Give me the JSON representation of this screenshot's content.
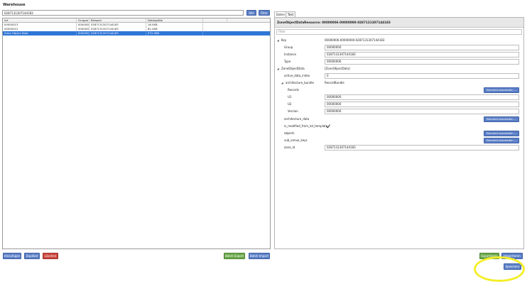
{
  "window": {
    "title": "Warehouse"
  },
  "left": {
    "search_value": "0287131307144183",
    "alle_label": "Alle",
    "filter_label": "Filter",
    "table": {
      "columns": [
        "Art",
        "Gruppe",
        "Beispiel",
        "Dateigröße"
      ],
      "rows": [
        [
          "00000013",
          "00000001",
          "0287131307144183",
          "16.0KB"
        ],
        [
          "00000012",
          "00000001",
          "0287131307144183",
          "82.4KB"
        ],
        [
          "Zone Object Data",
          "00000006",
          "0287131307144183",
          "572.5KB"
        ]
      ],
      "selected_row": 2
    },
    "bottom_buttons": {
      "hinzufuegen": "Hinzufügen",
      "duplikat": "Duplikat",
      "loeschen": "Löschen",
      "batch_export": "Batch Export",
      "batch_import": "Batch Import"
    }
  },
  "right": {
    "tabs": [
      "Daten",
      "Text"
    ],
    "active_tab": "Daten",
    "header": "ZoneObjectDataResource: 00000006-00000000-0287131307144183",
    "filter_placeholder": "Filter",
    "props": {
      "key_label": "Key",
      "key_value": "00000006-00000000-0287131307144183",
      "group_label": "Group",
      "group_value": "00000000",
      "instance_label": "Instance",
      "instance_value": "0287131307144183",
      "type_label": "Type",
      "type_value": "00000006",
      "zod_label": "ZoneObjectData",
      "zod_value": "[ZoneObjectData]",
      "active_label": "active_data_index",
      "active_value": "0",
      "arch_bundle_label": "architecture_bundle",
      "arch_bundle_value": "RecordBundle",
      "records_label": "Records",
      "u1_label": "U1",
      "u1_value": "00000000",
      "u2_label": "U2",
      "u2_value": "00000000",
      "version_label": "Version",
      "version_value": "00000000",
      "arch_data_label": "architecture_data",
      "is_modified_label": "is_modified_from_lot_template",
      "objects_label": "objects",
      "sub_venue_label": "sub_venue_keys",
      "zone_id_label": "zone_id",
      "zone_id_value": "0287131307144183"
    },
    "edit_button_label": "Elemente bearbeiten ...",
    "bottom_buttons": {
      "exportieren": "Exportieren",
      "importieren": "Importieren",
      "speichern": "Speichern"
    }
  },
  "colors": {
    "button_blue": "#5b7fc6",
    "button_green": "#6aa64a",
    "button_red": "#c9463e",
    "selection_blue": "#2f76d6",
    "highlight_yellow": "#f4ee2a"
  }
}
